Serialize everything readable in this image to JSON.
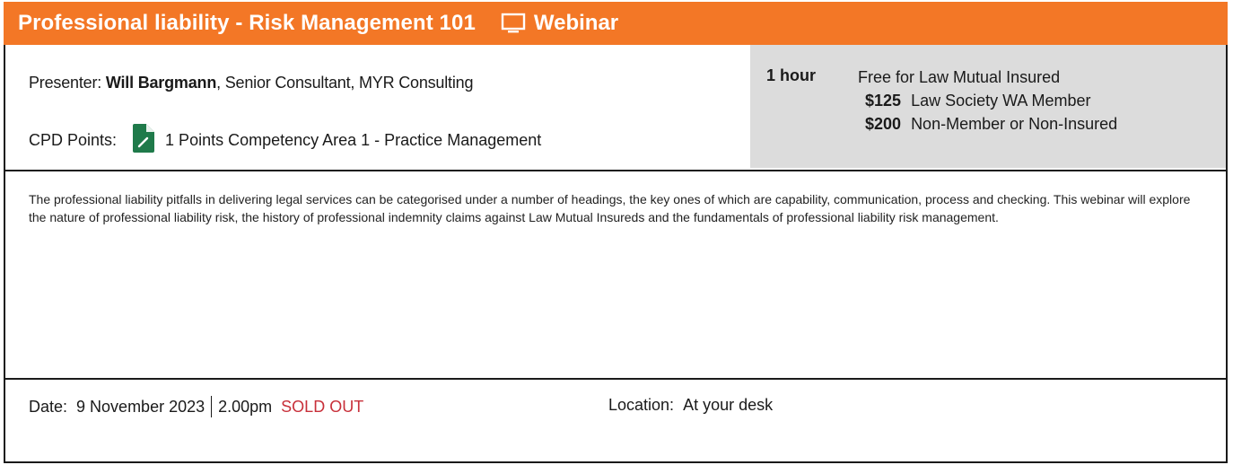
{
  "header": {
    "title": "Professional liability - Risk Management 101",
    "event_type": "Webinar",
    "accent_color": "#f37726"
  },
  "presenter": {
    "label": "Presenter:",
    "name": "Will Bargmann",
    "role": ", Senior Consultant, MYR Consulting"
  },
  "cpd": {
    "label": "CPD Points:",
    "icon": "document-edit-icon",
    "icon_color": "#1f7a4a",
    "text": "1 Points Competency Area 1 - Practice Management"
  },
  "pricing": {
    "duration": "1 hour",
    "free_text": "Free for Law Mutual Insured",
    "tiers": [
      {
        "amount": "$125",
        "label": "Law Society WA Member"
      },
      {
        "amount": "$200",
        "label": "Non-Member or Non-Insured"
      }
    ]
  },
  "description": "The professional liability pitfalls in delivering legal services can be categorised under a number of headings, the key ones of which are capability, communication, process and checking. This webinar will explore the nature of professional liability risk, the history of professional indemnity claims against Law Mutual Insureds and the fundamentals of professional liability risk management.",
  "footer": {
    "date_label": "Date:",
    "date": "9 November 2023",
    "time": "2.00pm",
    "status": "SOLD OUT",
    "status_color": "#c8303a",
    "location_label": "Location:",
    "location": "At your desk"
  }
}
